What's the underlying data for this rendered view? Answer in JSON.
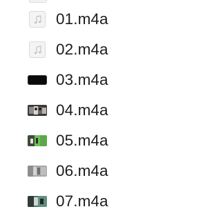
{
  "files": [
    {
      "name": "01.m4a",
      "icon": "audio-file-icon"
    },
    {
      "name": "02.m4a",
      "icon": "audio-file-icon"
    },
    {
      "name": "03.m4a",
      "icon": "black-artwork-thumbnail"
    },
    {
      "name": "04.m4a",
      "icon": "photo-artwork-thumbnail"
    },
    {
      "name": "05.m4a",
      "icon": "green-artwork-thumbnail"
    },
    {
      "name": "06.m4a",
      "icon": "gray-artwork-thumbnail"
    },
    {
      "name": "07.m4a",
      "icon": "teal-artwork-thumbnail"
    }
  ]
}
